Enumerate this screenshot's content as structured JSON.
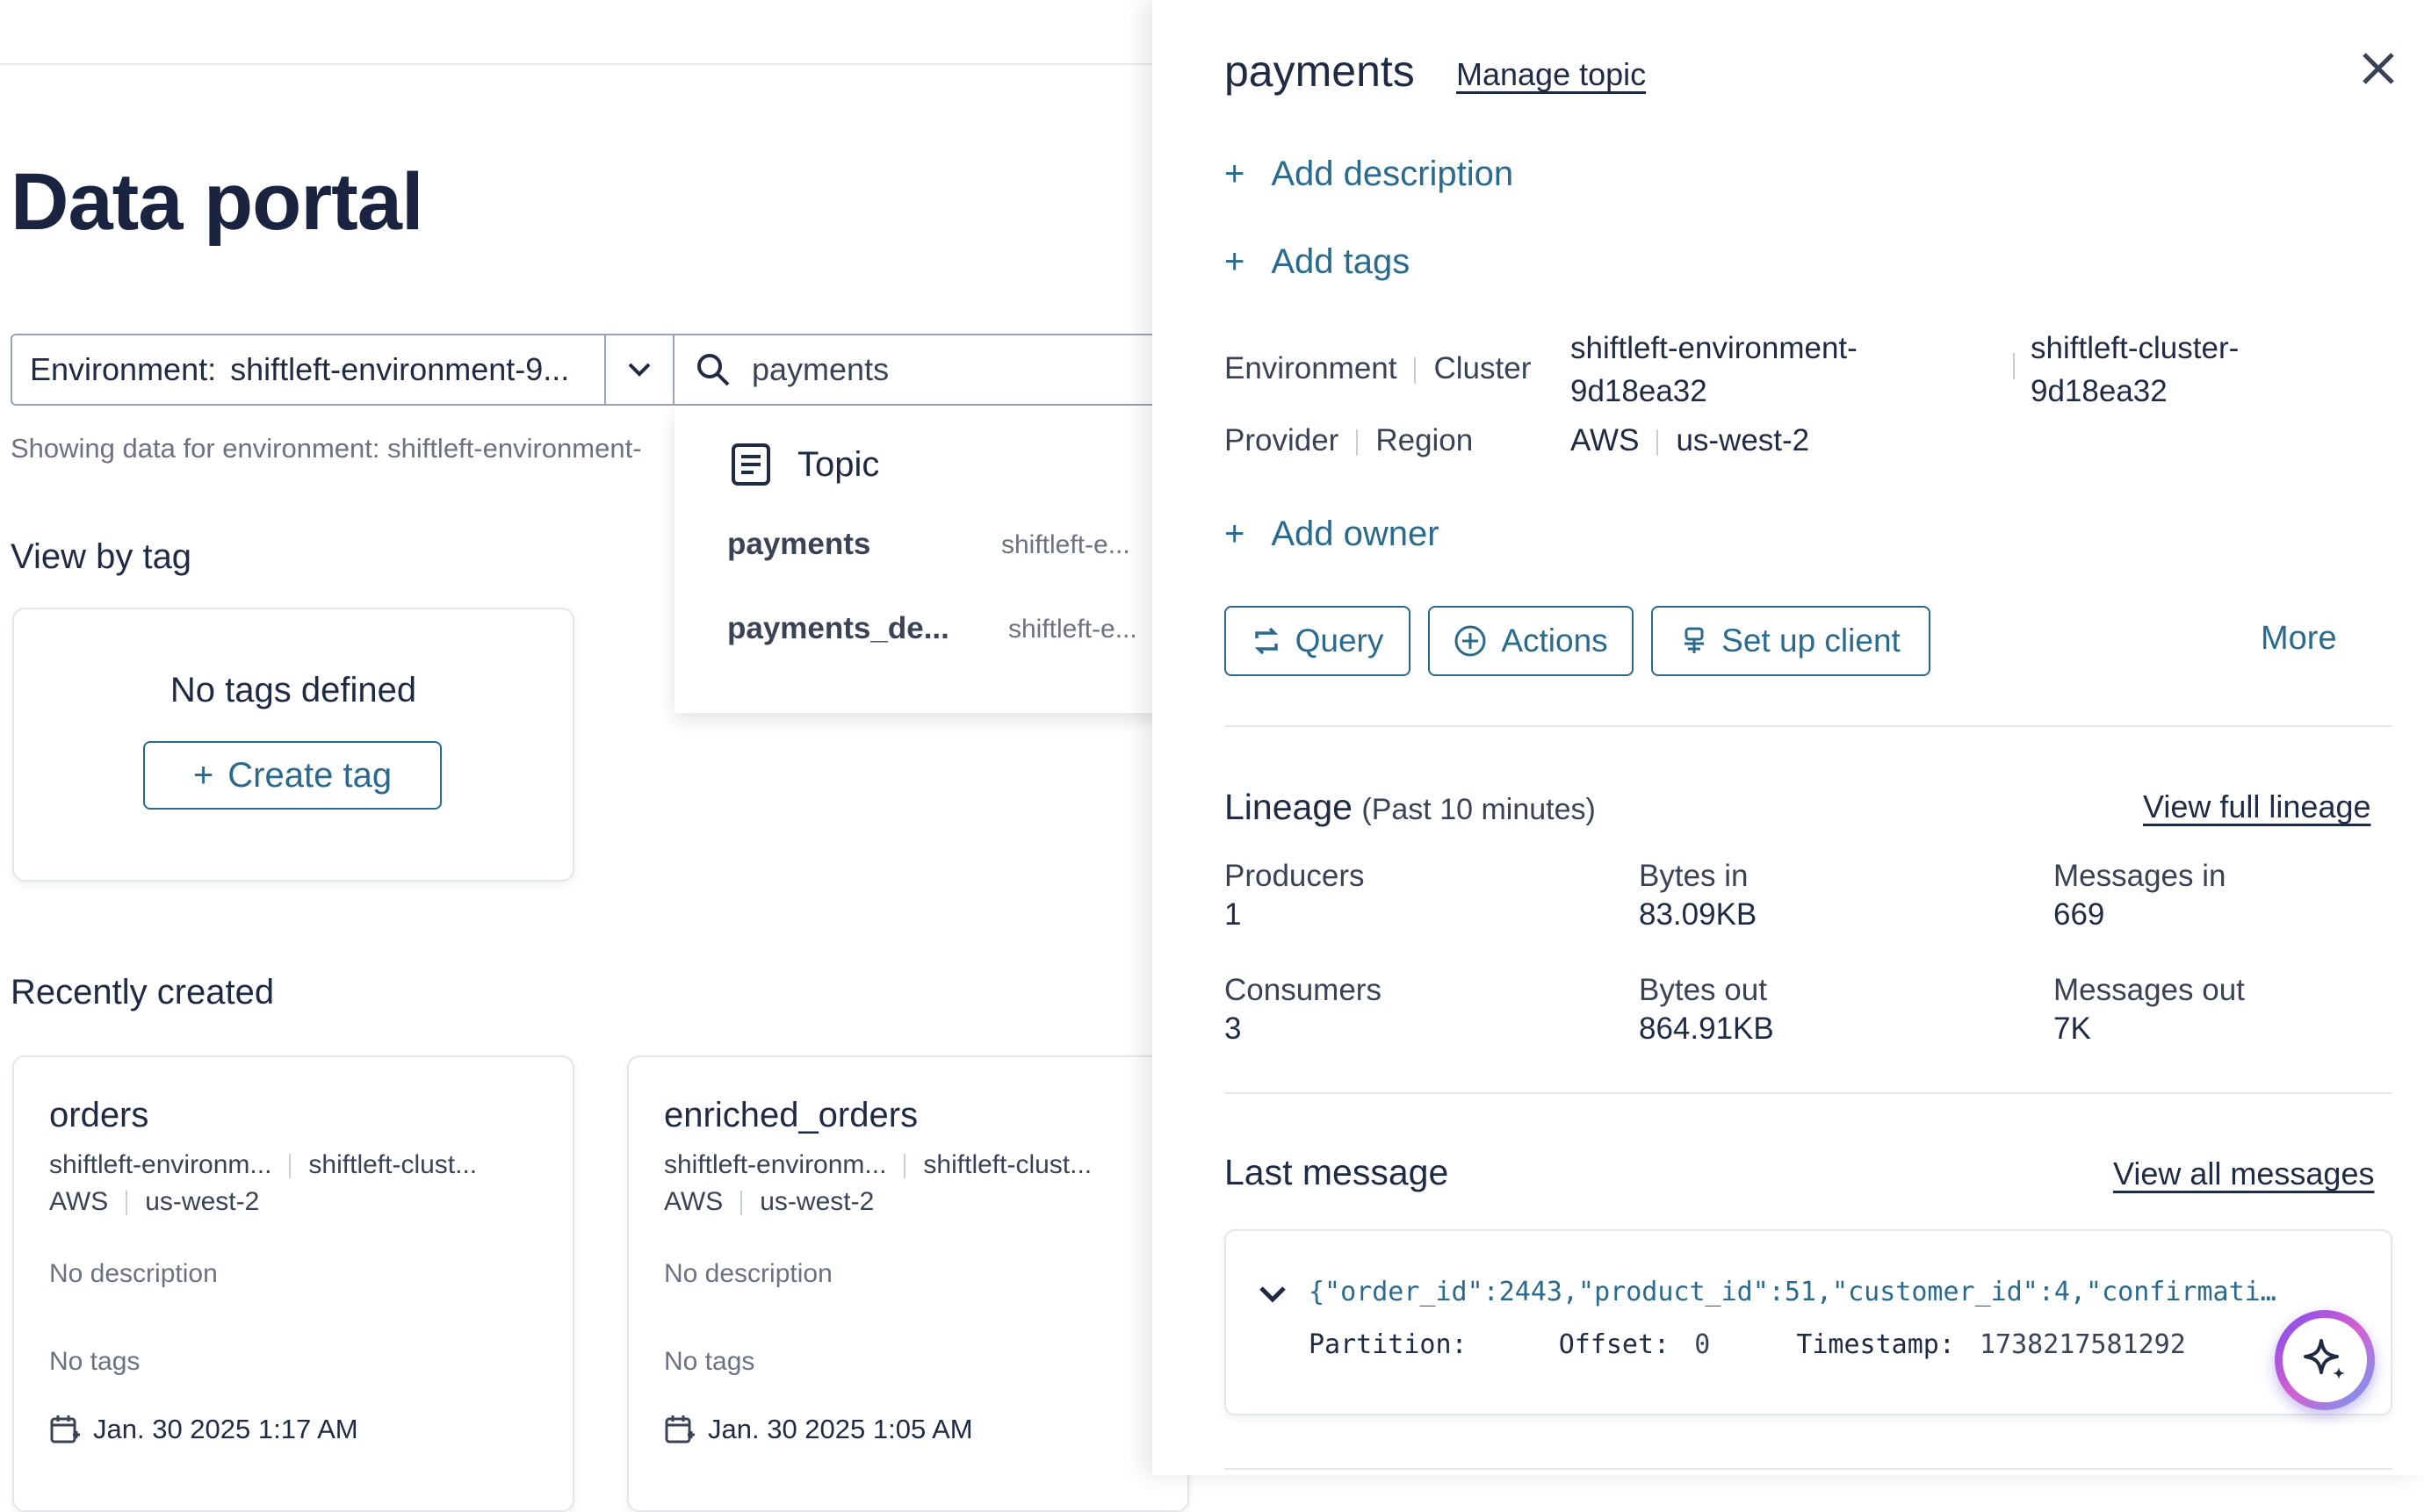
{
  "page": {
    "title": "Data portal"
  },
  "filter": {
    "env_label": "Environment:",
    "env_value": "shiftleft-environment-9...",
    "search_value": "payments",
    "showing_text": "Showing data for environment: shiftleft-environment-"
  },
  "dropdown": {
    "group_label": "Topic",
    "items": [
      {
        "name": "payments",
        "env": "shiftleft-e..."
      },
      {
        "name": "payments_de...",
        "env": "shiftleft-e..."
      }
    ]
  },
  "tags_section": {
    "heading": "View by tag",
    "empty_text": "No tags defined",
    "create_label": "Create tag"
  },
  "recent": {
    "heading": "Recently created",
    "cards": [
      {
        "name": "orders",
        "env": "shiftleft-environm...",
        "cluster": "shiftleft-clust...",
        "provider": "AWS",
        "region": "us-west-2",
        "description": "No description",
        "tags": "No tags",
        "date": "Jan. 30 2025 1:17 AM"
      },
      {
        "name": "enriched_orders",
        "env": "shiftleft-environm...",
        "cluster": "shiftleft-clust...",
        "provider": "AWS",
        "region": "us-west-2",
        "description": "No description",
        "tags": "No tags",
        "date": "Jan. 30 2025 1:05 AM"
      }
    ]
  },
  "panel": {
    "title": "payments",
    "manage_link": "Manage topic",
    "add_description": "Add description",
    "add_tags": "Add tags",
    "add_owner": "Add owner",
    "meta": {
      "env_label": "Environment",
      "cluster_label": "Cluster",
      "env_value_line1": "shiftleft-environment-",
      "env_value_line2": "9d18ea32",
      "cluster_value_line1": "shiftleft-cluster-",
      "cluster_value_line2": "9d18ea32",
      "provider_label": "Provider",
      "region_label": "Region",
      "provider_value": "AWS",
      "region_value": "us-west-2"
    },
    "buttons": {
      "query": "Query",
      "actions": "Actions",
      "setup": "Set up client",
      "more": "More"
    },
    "lineage": {
      "title": "Lineage",
      "subtitle": "(Past 10 minutes)",
      "view_link": "View full lineage",
      "stats": [
        {
          "label": "Producers",
          "value": "1"
        },
        {
          "label": "Bytes in",
          "value": "83.09KB"
        },
        {
          "label": "Messages in",
          "value": "669"
        },
        {
          "label": "Consumers",
          "value": "3"
        },
        {
          "label": "Bytes out",
          "value": "864.91KB"
        },
        {
          "label": "Messages out",
          "value": "7K"
        }
      ]
    },
    "last_message": {
      "title": "Last message",
      "view_link": "View all messages",
      "payload": "{\"order_id\":2443,\"product_id\":51,\"customer_id\":4,\"confirmati…",
      "partition_label": "Partition:",
      "offset_label": "Offset:",
      "offset_value": "0",
      "timestamp_label": "Timestamp:",
      "timestamp_value": "1738217581292"
    }
  },
  "colors": {
    "accent": "#2a6a8f",
    "text": "#1f2a44",
    "muted": "#6b7280",
    "border": "#e3e6ea"
  }
}
